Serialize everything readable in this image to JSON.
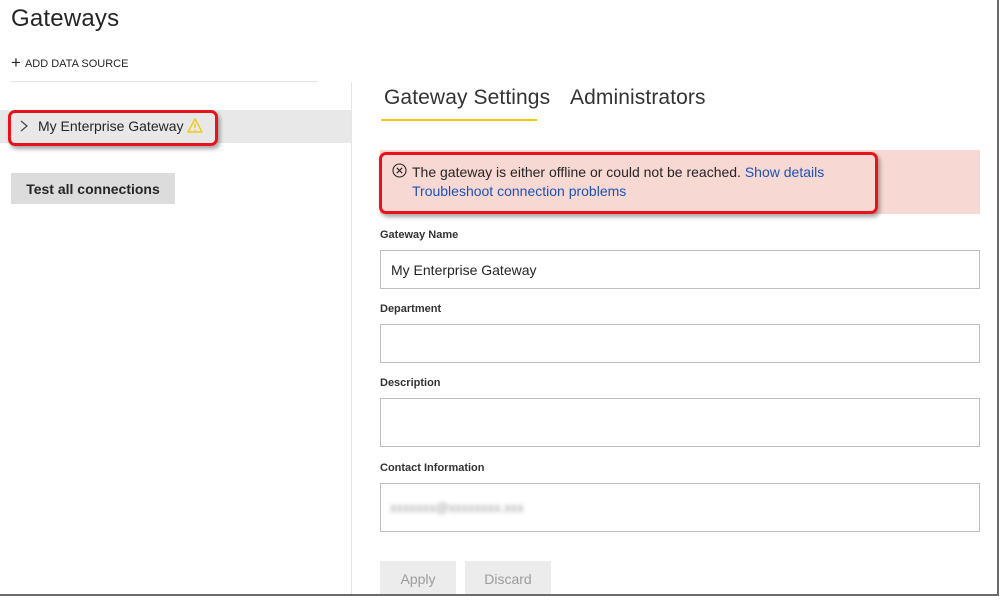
{
  "page": {
    "title": "Gateways"
  },
  "sidebar": {
    "add_data_source": "ADD DATA SOURCE",
    "gateway_item": "My Enterprise Gateway",
    "test_all": "Test all connections"
  },
  "tabs": [
    {
      "label": "Gateway Settings",
      "active": true
    },
    {
      "label": "Administrators",
      "active": false
    }
  ],
  "error": {
    "message": "The gateway is either offline or could not be reached.",
    "show_details": "Show details",
    "troubleshoot": "Troubleshoot connection problems"
  },
  "form": {
    "gateway_name_label": "Gateway Name",
    "gateway_name_value": "My Enterprise Gateway",
    "department_label": "Department",
    "department_value": "",
    "description_label": "Description",
    "description_value": "",
    "contact_label": "Contact Information",
    "apply": "Apply",
    "discard": "Discard"
  },
  "colors": {
    "accent_underline": "#f2c811",
    "error_background": "#f7d8d2",
    "link": "#1b53b7",
    "warning": "#f2c811",
    "callout": "#e8121a"
  },
  "icons": {
    "expand": "chevron-right-icon",
    "warning": "warning-triangle-icon",
    "error": "error-circle-icon",
    "add": "plus-icon"
  }
}
